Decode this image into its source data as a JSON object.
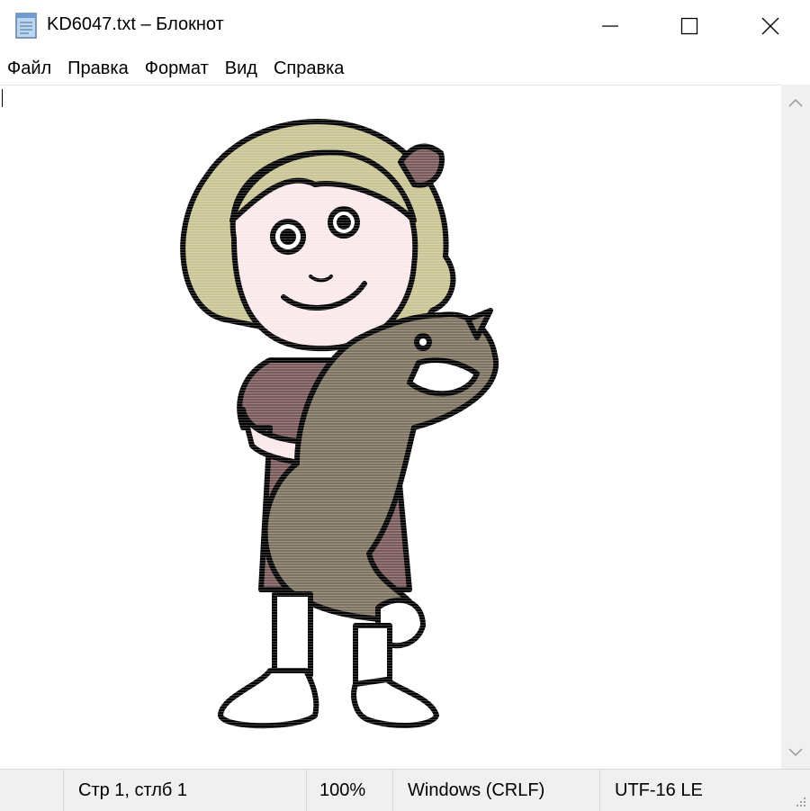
{
  "window": {
    "title": "KD6047.txt – Блокнот",
    "icons": [
      "notepad-icon",
      "minimize-icon",
      "maximize-icon",
      "close-icon"
    ]
  },
  "menu": {
    "items": [
      "Файл",
      "Правка",
      "Формат",
      "Вид",
      "Справка"
    ]
  },
  "editor": {
    "content_icon": "girl-holding-cat-illustration",
    "colors": {
      "hair": "#c8c493",
      "skin": "#fbe8ea",
      "dress": "#7a5a5a",
      "cat": "#7d7360",
      "outline": "#000000"
    }
  },
  "statusbar": {
    "position": "Стр 1, стлб 1",
    "zoom": "100%",
    "line_endings": "Windows (CRLF)",
    "encoding": "UTF-16 LE"
  }
}
